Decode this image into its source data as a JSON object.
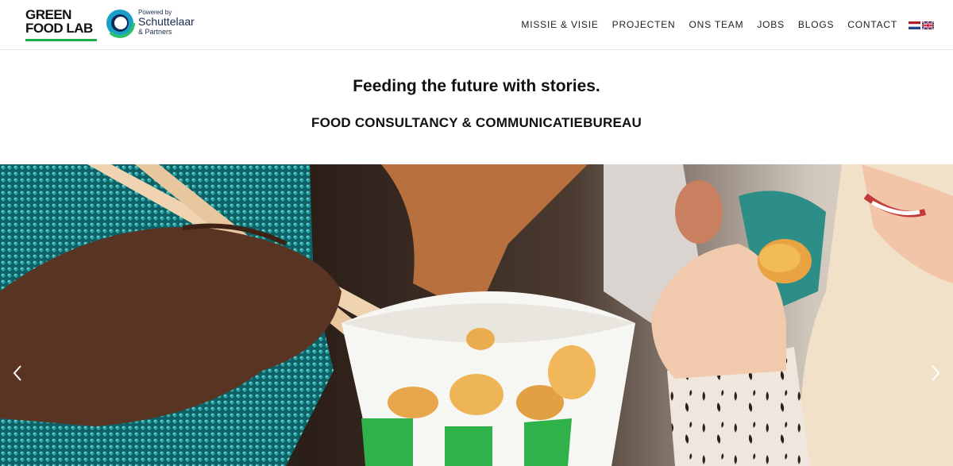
{
  "header": {
    "logo": {
      "line1": "GREEN",
      "line2": "FOOD LAB",
      "accent_color": "#1fae49"
    },
    "partner_logo": {
      "powered_by": "Powered by",
      "name": "Schuttelaar",
      "suffix": "& Partners"
    },
    "nav": [
      {
        "label": "MISSIE & VISIE"
      },
      {
        "label": "PROJECTEN"
      },
      {
        "label": "ONS TEAM"
      },
      {
        "label": "JOBS"
      },
      {
        "label": "BLOGS"
      },
      {
        "label": "CONTACT"
      }
    ],
    "languages": [
      {
        "icon": "flag-nl-icon"
      },
      {
        "icon": "flag-gb-icon"
      }
    ]
  },
  "hero": {
    "tagline": "Feeding the future with stories.",
    "subtitle": "FOOD CONSULTANCY & COMMUNICATIEBUREAU"
  },
  "slider": {
    "prev_icon": "chevron-left-icon",
    "next_icon": "chevron-right-icon"
  }
}
